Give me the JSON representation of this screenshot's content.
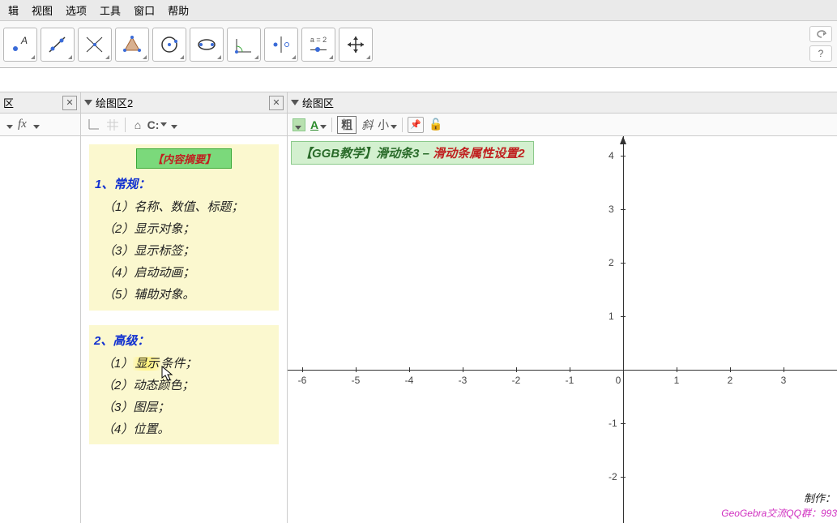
{
  "menu": {
    "edit": "辑",
    "view": "视图",
    "options": "选项",
    "tools": "工具",
    "window": "窗口",
    "help": "帮助"
  },
  "toolbar": {
    "slider_label": "a = 2"
  },
  "panel_left": {
    "title": "区",
    "fx": "fx"
  },
  "panel_mid": {
    "title": "绘图区2",
    "summary_title": "【内容摘要】",
    "sec1_head": "1、常规：",
    "sec1_items": [
      "（1）名称、数值、标题；",
      "（2）显示对象；",
      "（3）显示标签；",
      "（4）启动动画；",
      "（5）辅助对象。"
    ],
    "sec2_head": "2、高级：",
    "sec2_items": [
      "（1）显示条件；",
      "（2）动态颜色；",
      "（3）图层；",
      "（4）位置。"
    ]
  },
  "panel_right": {
    "title": "绘图区",
    "style_bold": "粗",
    "style_italic": "斜",
    "style_size": "小",
    "banner_a": "【GGB教学】滑动条3 –",
    "banner_b": " 滑动条属性设置2",
    "footer1": "制作：",
    "footer2": "GeoGebra交流QQ群：993"
  },
  "chart_data": {
    "type": "line",
    "title": "",
    "xlabel": "",
    "ylabel": "",
    "x_ticks": [
      -6,
      -5,
      -4,
      -3,
      -2,
      -1,
      0,
      1,
      2,
      3
    ],
    "y_ticks": [
      -2,
      -1,
      1,
      2,
      3,
      4
    ],
    "xlim": [
      -6.5,
      3.5
    ],
    "ylim": [
      -2.5,
      4.2
    ],
    "series": []
  }
}
